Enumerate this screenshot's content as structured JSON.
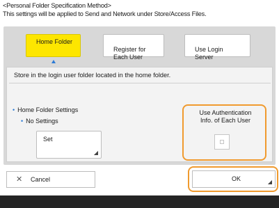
{
  "header": {
    "title": "<Personal Folder Specification Method>",
    "subtitle": "This settings will be applied to Send and Network under Store/Access Files."
  },
  "tabs": [
    {
      "label": "Home Folder",
      "selected": true
    },
    {
      "label": "Register for\nEach User",
      "selected": false
    },
    {
      "label": "Use Login\nServer",
      "selected": false
    }
  ],
  "content": {
    "description": "Store in the login user folder located in the home folder.",
    "home_folder_settings_label": "Home Folder Settings",
    "home_folder_settings_value": "No Settings",
    "set_button_label": "Set",
    "auth_label": "Use Authentication\nInfo. of Each User",
    "auth_checked": false
  },
  "footer": {
    "cancel_label": "Cancel",
    "ok_label": "OK"
  },
  "icons": {
    "cancel": "close-icon",
    "corner": "corner-triangle-icon"
  },
  "colors": {
    "selected_tab": "#fde600",
    "highlight_outline": "#f09a2e",
    "accent_blue": "#2c7bd6"
  }
}
